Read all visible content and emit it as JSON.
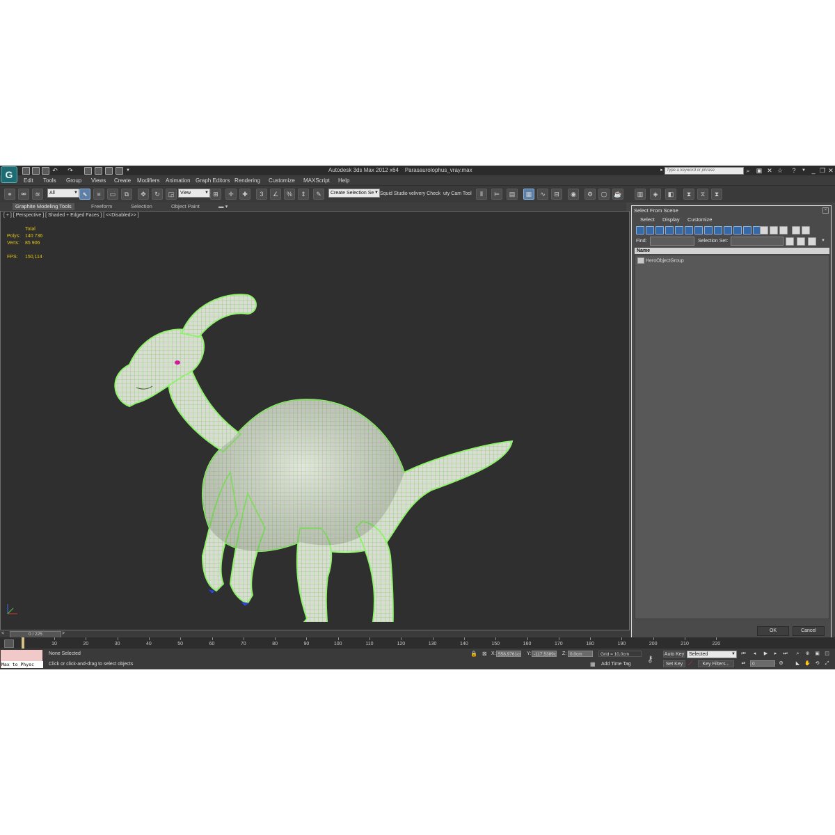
{
  "window": {
    "app_title": "Autodesk 3ds Max  2012 x64",
    "file_name": "Parasaurolophus_vray.max",
    "search_placeholder": "Type a keyword or phrase",
    "logo": "3ds-max-logo"
  },
  "menu": [
    "Edit",
    "Tools",
    "Group",
    "Views",
    "Create",
    "Modifiers",
    "Animation",
    "Graph Editors",
    "Rendering",
    "Customize",
    "MAXScript",
    "Help"
  ],
  "toolbar": {
    "filter_value": "All",
    "ref_coord_value": "View",
    "create_selection_set": "Create Selection Se",
    "squid_studio": "Squid Studio v",
    "delivery_check": "elivery Check",
    "beauty_cam": "uty Cam Tool",
    "snap_label": "3"
  },
  "ribbon": {
    "tabs": [
      "Graphite Modeling Tools",
      "Freeform",
      "Selection",
      "Object Paint"
    ]
  },
  "viewport": {
    "label": "[ + ] [ Perspective ] [ Shaded + Edged Faces ] [ <<Disabled>> ]",
    "stats": {
      "total_label": "Total",
      "polys_label": "Polys:",
      "polys_value": "140 736",
      "verts_label": "Verts:",
      "verts_value": "85 906",
      "fps_label": "FPS:",
      "fps_value": "150,114"
    },
    "colors": {
      "background": "#2f2f2f",
      "mesh": "#8ef26a",
      "claws": "#3346c8"
    }
  },
  "scene_panel": {
    "title": "Select From Scene",
    "menu": [
      "Select",
      "Display",
      "Customize"
    ],
    "find_label": "Find:",
    "selection_set_label": "Selection Set:",
    "column_name": "Name",
    "items": [
      "HeroObjectGroup"
    ],
    "ok_label": "OK",
    "cancel_label": "Cancel"
  },
  "timeline": {
    "frame_display": "0 / 225",
    "ticks": [
      "10",
      "20",
      "30",
      "40",
      "50",
      "60",
      "70",
      "80",
      "90",
      "100",
      "110",
      "120",
      "130",
      "140",
      "150",
      "160",
      "170",
      "180",
      "190",
      "200",
      "210",
      "220"
    ]
  },
  "status": {
    "maxscript_label": "Max to Physc",
    "selection_status": "None Selected",
    "prompt": "Click or click-and-drag to select objects",
    "x_label": "X:",
    "x_value": "558,9761cm",
    "y_label": "Y:",
    "y_value": "-117,5389c",
    "z_label": "Z:",
    "z_value": "0,0cm",
    "grid": "Grid = 10,0cm",
    "add_time_tag": "Add Time Tag",
    "auto_key": "Auto Key",
    "selected_dropdown": "Selected",
    "set_key": "Set Key",
    "key_filters": "Key Filters...",
    "frame_value": "0"
  }
}
